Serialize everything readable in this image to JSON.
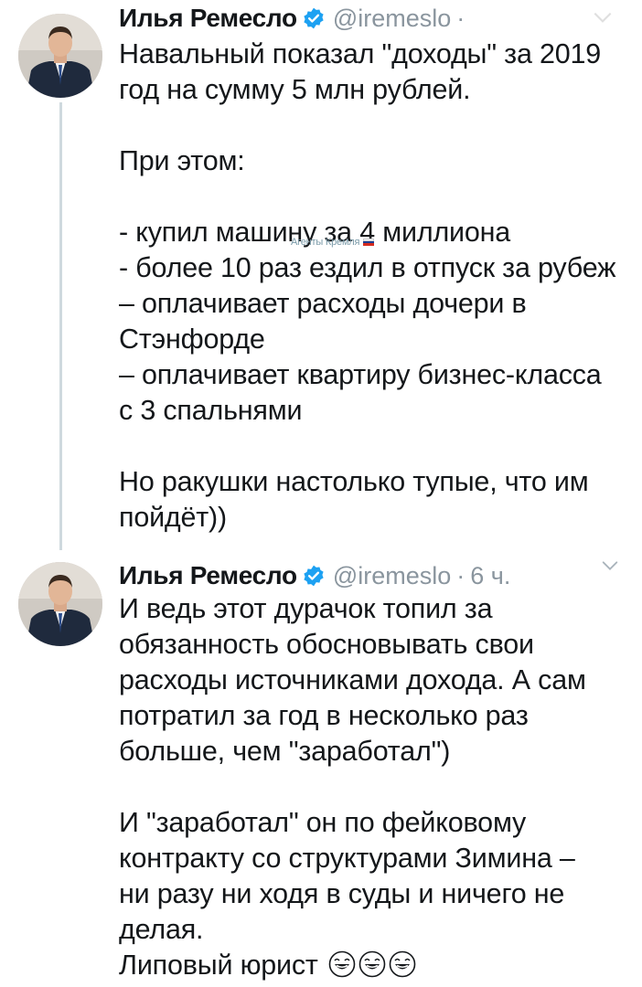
{
  "tweets": [
    {
      "author": {
        "name": "Илья Ремесло",
        "handle": "@iremeslo",
        "verified": true,
        "avatar": "profile-photo"
      },
      "separator": "·",
      "time": "",
      "lines": [
        "Навальный показал \"доходы\" за 2019",
        "год на сумму 5 млн рублей.",
        "",
        "При этом:",
        "",
        "- купил машину за 4 миллиона",
        "- более 10 раз ездил в отпуск за рубеж",
        "– оплачивает расходы дочери в",
        "Стэнфорде",
        "– оплачивает квартиру бизнес-класса",
        "с 3 спальнями",
        "",
        "Но ракушки настолько тупые, что им",
        "пойдёт))"
      ]
    },
    {
      "author": {
        "name": "Илья Ремесло",
        "handle": "@iremeslo",
        "verified": true,
        "avatar": "profile-photo"
      },
      "separator": "·",
      "time": "6 ч.",
      "lines": [
        "И ведь этот дурачок топил за",
        "обязанность обосновывать свои",
        "расходы источниками дохода. А сам",
        "потратил за год в несколько раз",
        "больше, чем \"заработал\")",
        "",
        "И \"заработал\" он по фейковому",
        "контракту со структурами Зимина –",
        "ни разу ни ходя в суды и ничего не",
        "делая.",
        "Липовый юрист"
      ],
      "emojis": [
        "joy-emoji",
        "joy-emoji",
        "joy-emoji"
      ]
    }
  ],
  "watermark": {
    "text": "Агенты Кремля",
    "flag_icon": "russia-flag-icon"
  },
  "colors": {
    "text": "#14171a",
    "secondary": "#8a959e",
    "verified": "#1da1f2",
    "thread_line": "#cfd9de"
  }
}
